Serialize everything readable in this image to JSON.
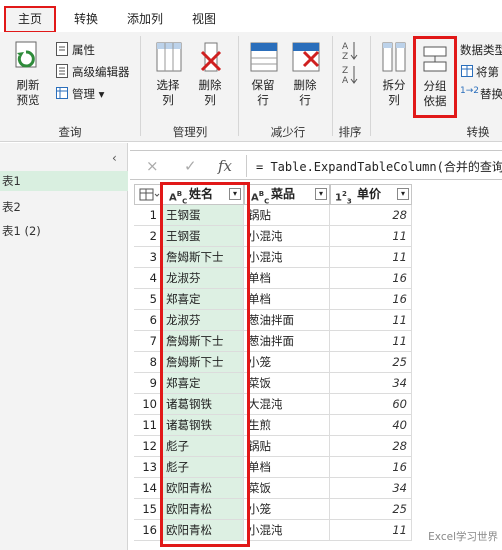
{
  "tabs": [
    {
      "label": "主页",
      "active": true
    },
    {
      "label": "转换",
      "active": false
    },
    {
      "label": "添加列",
      "active": false
    },
    {
      "label": "视图",
      "active": false
    }
  ],
  "ribbon": {
    "query_group": {
      "label": "查询",
      "refresh": "刷新\n预览",
      "properties": "属性",
      "advanced_editor": "高级编辑器",
      "manage": "管理"
    },
    "manage_columns_group": {
      "label": "管理列",
      "choose_columns": "选择\n列",
      "remove_columns": "删除\n列"
    },
    "reduce_rows_group": {
      "label": "减少行",
      "keep_rows": "保留\n行",
      "remove_rows": "删除\n行"
    },
    "sort_group": {
      "label": "排序"
    },
    "transform_group": {
      "label": "转换",
      "split_column": "拆分\n列",
      "group_by": "分组\n依据",
      "data_type": "数据类型",
      "use_first_row": "将第",
      "replace_values": "替换"
    }
  },
  "queries": [
    {
      "label": "表1"
    },
    {
      "label": "表2"
    },
    {
      "label": "表1 (2)"
    }
  ],
  "formula": {
    "cancel_icon": "×",
    "confirm_icon": "✓",
    "fx": "fx",
    "text": "= Table.ExpandTableColumn(合并的查询,"
  },
  "columns": [
    {
      "name": "姓名",
      "type": "ABC"
    },
    {
      "name": "菜品",
      "type": "ABC"
    },
    {
      "name": "单价",
      "type": "123"
    }
  ],
  "rows": [
    {
      "n": "1",
      "name": "王钢蛋",
      "dish": "锅贴",
      "price": "28"
    },
    {
      "n": "2",
      "name": "王钢蛋",
      "dish": "小混沌",
      "price": "11"
    },
    {
      "n": "3",
      "name": "詹姆斯下士",
      "dish": "小混沌",
      "price": "11"
    },
    {
      "n": "4",
      "name": "龙淑芬",
      "dish": "单档",
      "price": "16"
    },
    {
      "n": "5",
      "name": "郑喜定",
      "dish": "单档",
      "price": "16"
    },
    {
      "n": "6",
      "name": "龙淑芬",
      "dish": "葱油拌面",
      "price": "11"
    },
    {
      "n": "7",
      "name": "詹姆斯下士",
      "dish": "葱油拌面",
      "price": "11"
    },
    {
      "n": "8",
      "name": "詹姆斯下士",
      "dish": "小笼",
      "price": "25"
    },
    {
      "n": "9",
      "name": "郑喜定",
      "dish": "菜饭",
      "price": "34"
    },
    {
      "n": "10",
      "name": "诸葛钢铁",
      "dish": "大混沌",
      "price": "60"
    },
    {
      "n": "11",
      "name": "诸葛钢铁",
      "dish": "生煎",
      "price": "40"
    },
    {
      "n": "12",
      "name": "彪子",
      "dish": "锅贴",
      "price": "28"
    },
    {
      "n": "13",
      "name": "彪子",
      "dish": "单档",
      "price": "16"
    },
    {
      "n": "14",
      "name": "欧阳青松",
      "dish": "菜饭",
      "price": "34"
    },
    {
      "n": "15",
      "name": "欧阳青松",
      "dish": "小笼",
      "price": "25"
    },
    {
      "n": "16",
      "name": "欧阳青松",
      "dish": "小混沌",
      "price": "11"
    }
  ],
  "watermark": "Excel学习世界",
  "colors": {
    "highlight_red": "#e11818",
    "column_green": "#ddf0e3",
    "ribbon_bg": "#f3f3f3"
  }
}
